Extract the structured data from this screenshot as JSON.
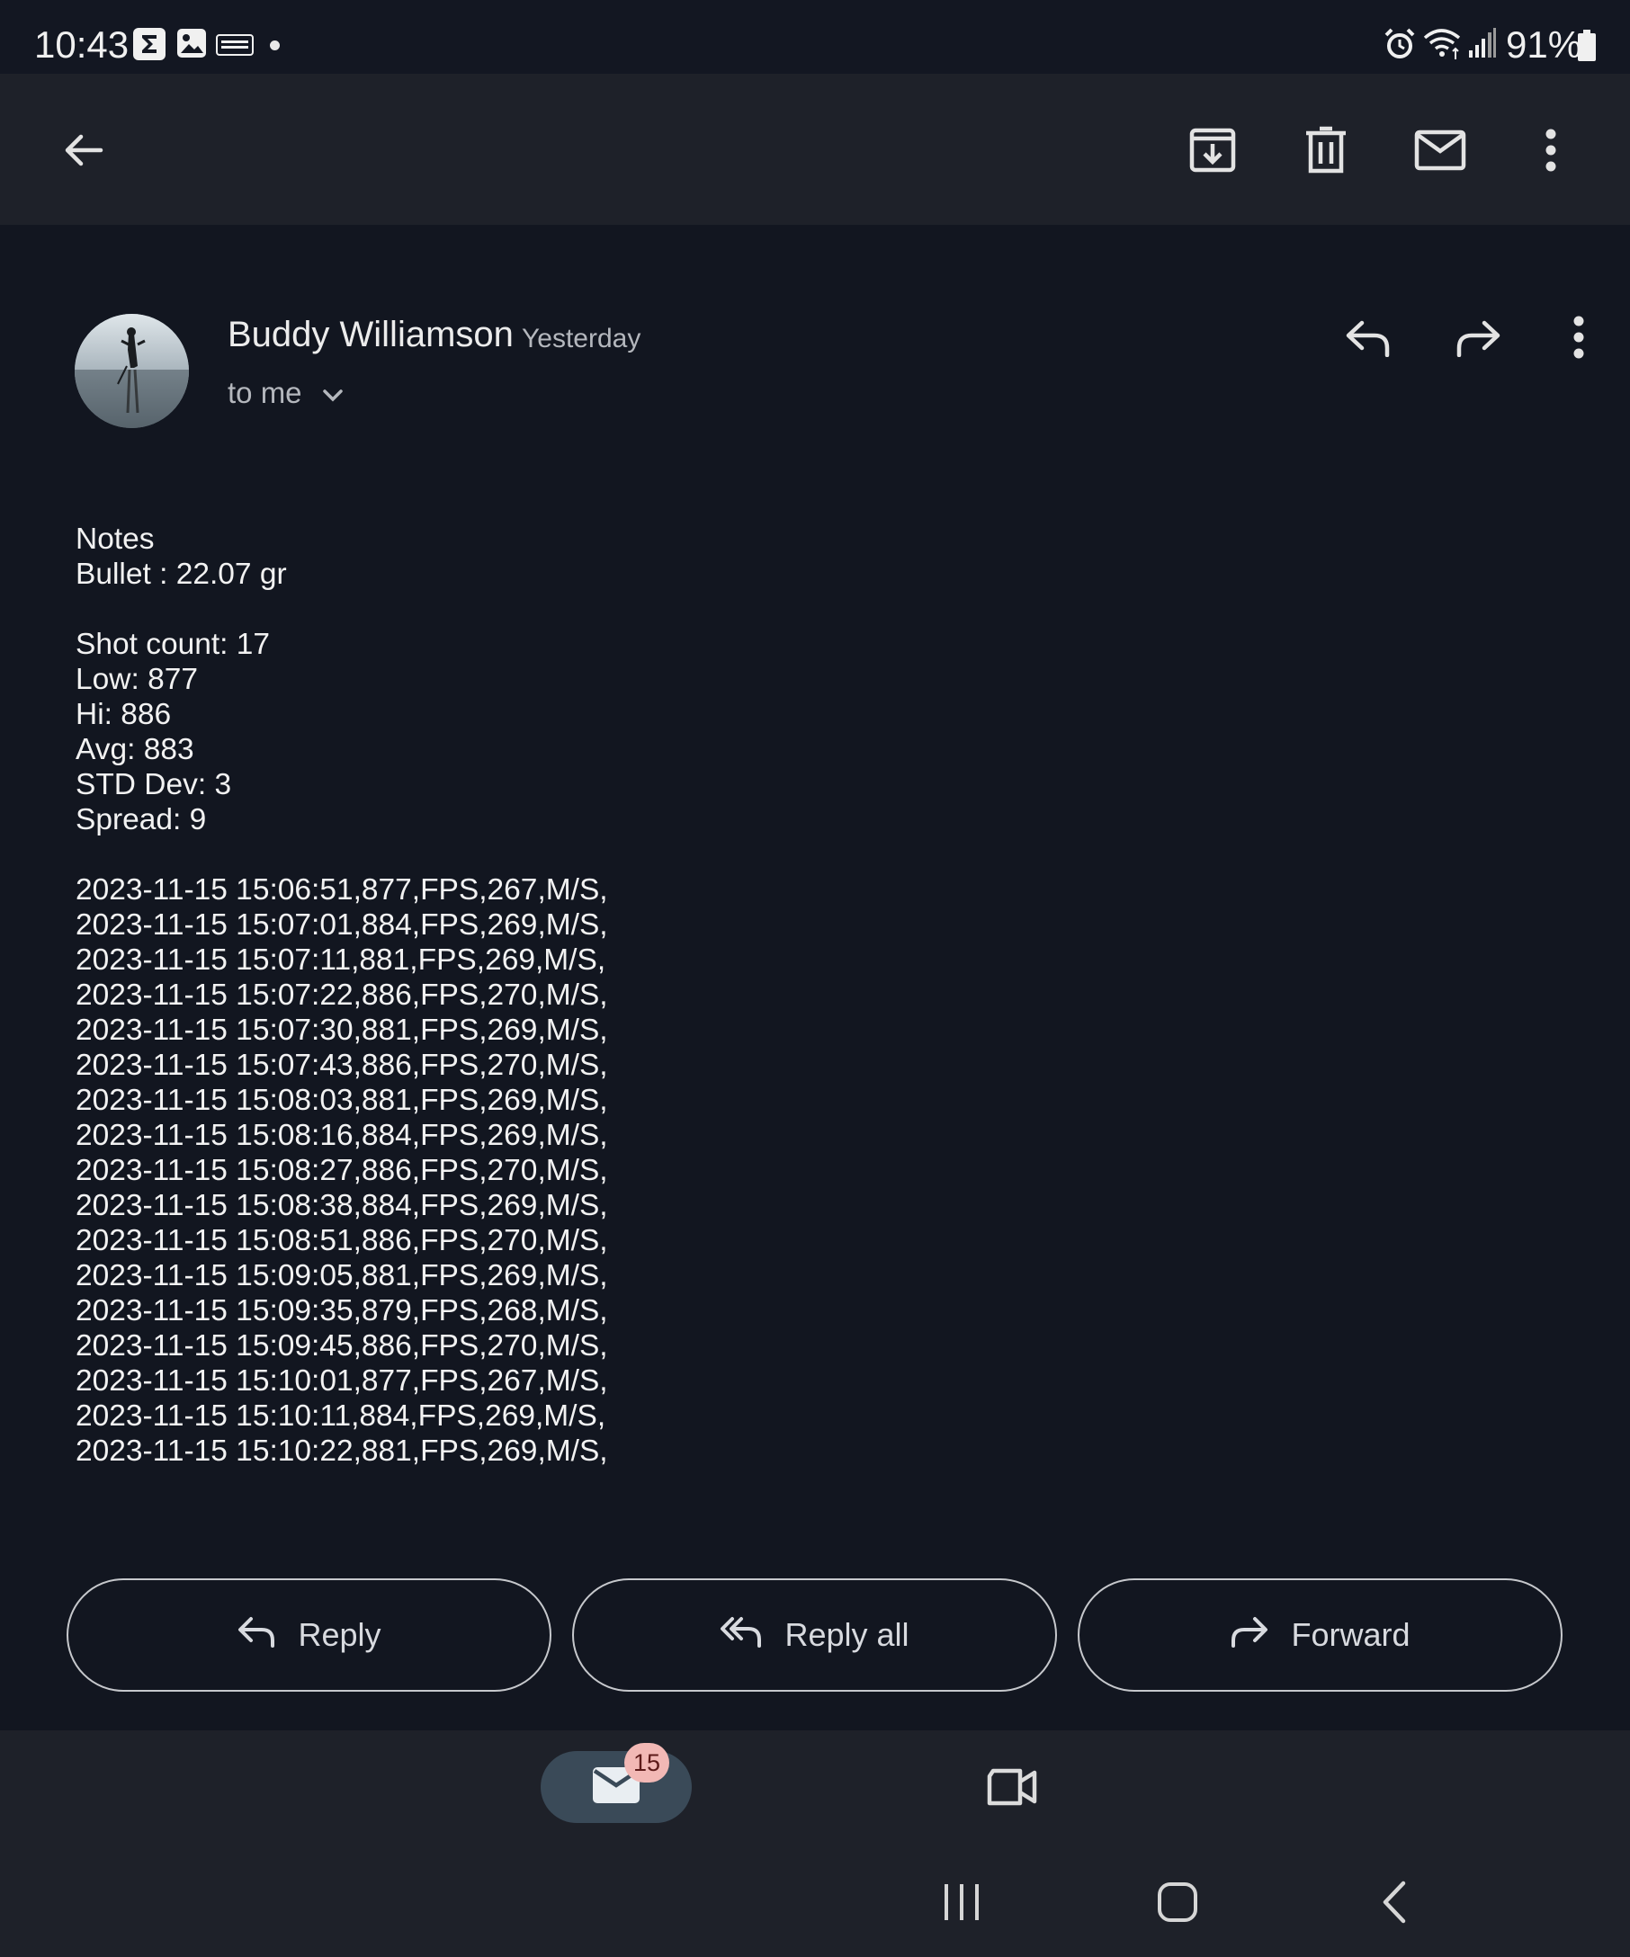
{
  "status_bar": {
    "time": "10:43",
    "battery_percent": "91%",
    "notification_icons": [
      "sigma-app-icon",
      "gallery-icon",
      "news-app-icon",
      "dot-icon"
    ],
    "system_icons": [
      "alarm-icon",
      "wifi-icon",
      "signal-icon",
      "battery-icon"
    ]
  },
  "toolbar": {
    "icons": [
      "back-arrow-icon",
      "archive-icon",
      "delete-icon",
      "mark-unread-icon",
      "more-vert-icon"
    ]
  },
  "message": {
    "sender": "Buddy Williamson",
    "date": "Yesterday",
    "recipient_label": "to me",
    "header_icons": [
      "reply-icon",
      "forward-icon",
      "more-vert-icon"
    ]
  },
  "body": {
    "notes_header": "Notes",
    "bullet": "Bullet : 22.07 gr",
    "stats": [
      "Shot count: 17",
      "Low: 877",
      "Hi: 886",
      "Avg: 883",
      "STD Dev: 3",
      "Spread: 9"
    ],
    "shots": [
      "2023-11-15 15:06:51,877,FPS,267,M/S,",
      "2023-11-15 15:07:01,884,FPS,269,M/S,",
      "2023-11-15 15:07:11,881,FPS,269,M/S,",
      "2023-11-15 15:07:22,886,FPS,270,M/S,",
      "2023-11-15 15:07:30,881,FPS,269,M/S,",
      "2023-11-15 15:07:43,886,FPS,270,M/S,",
      "2023-11-15 15:08:03,881,FPS,269,M/S,",
      "2023-11-15 15:08:16,884,FPS,269,M/S,",
      "2023-11-15 15:08:27,886,FPS,270,M/S,",
      "2023-11-15 15:08:38,884,FPS,269,M/S,",
      "2023-11-15 15:08:51,886,FPS,270,M/S,",
      "2023-11-15 15:09:05,881,FPS,269,M/S,",
      "2023-11-15 15:09:35,879,FPS,268,M/S,",
      "2023-11-15 15:09:45,886,FPS,270,M/S,",
      "2023-11-15 15:10:01,877,FPS,267,M/S,",
      "2023-11-15 15:10:11,884,FPS,269,M/S,",
      "2023-11-15 15:10:22,881,FPS,269,M/S,"
    ]
  },
  "actions": {
    "reply_label": "Reply",
    "reply_all_label": "Reply all",
    "forward_label": "Forward"
  },
  "bottom_nav": {
    "mail_badge": "15",
    "items": [
      "mail-icon",
      "meet-video-icon"
    ]
  },
  "system_nav": [
    "recent-apps-icon",
    "home-icon",
    "back-icon"
  ],
  "colors": {
    "background": "#121620",
    "bar_background": "#1e2129",
    "badge": "#f2b8b5",
    "pill": "#3a4a58"
  }
}
